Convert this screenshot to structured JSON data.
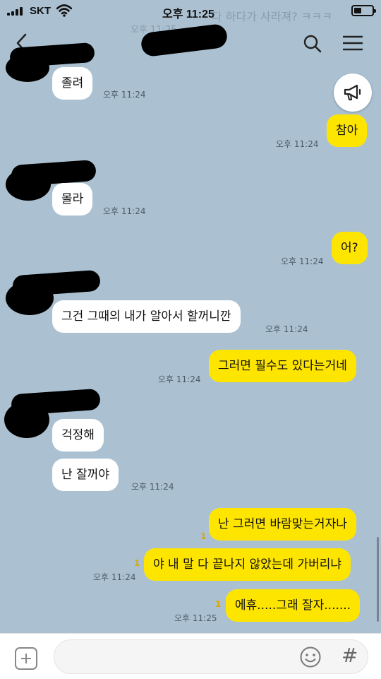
{
  "status_bar": {
    "carrier": "SKT",
    "time": "오후 11:25"
  },
  "ghost_preview": {
    "text": "다 하다가 사라져? ㅋㅋㅋ",
    "time": "오후 11:25"
  },
  "header": {
    "back_icon": "chevron-left-icon",
    "search_icon": "search-icon",
    "menu_icon": "hamburger-menu-icon",
    "notice_icon": "megaphone-icon"
  },
  "messages": [
    {
      "side": "in",
      "text": "졸려",
      "time": "오후 11:24"
    },
    {
      "side": "out",
      "text": "참아",
      "time": "오후 11:24"
    },
    {
      "side": "in",
      "text": "몰라",
      "time": "오후 11:24"
    },
    {
      "side": "out",
      "text": "어?",
      "time": "오후 11:24"
    },
    {
      "side": "in",
      "text": "그건 그때의 내가 알아서 할꺼니깐",
      "time": "오후 11:24"
    },
    {
      "side": "out",
      "text": "그러면 필수도 있다는거네",
      "time": "오후 11:24"
    },
    {
      "side": "in",
      "text": "걱정해"
    },
    {
      "side": "in",
      "text": "난 잘꺼야",
      "time": "오후 11:24"
    },
    {
      "side": "out",
      "text": "난 그러면 바람맞는거자나",
      "unread": "1"
    },
    {
      "side": "out",
      "text": "야 내 말 다 끝나지 않았는데 가버리냐",
      "time": "오후 11:24",
      "unread": "1"
    },
    {
      "side": "out",
      "text": "에휴.....그래 잘자.......",
      "time": "오후 11:25",
      "unread": "1"
    }
  ],
  "input_bar": {
    "add_icon": "plus-square-icon",
    "placeholder": "",
    "emoji_icon": "emoji-icon",
    "hashtag_icon": "hashtag-icon",
    "hashtag_glyph": "#"
  },
  "colors": {
    "background": "#abc1d1",
    "outgoing_bubble": "#fee500",
    "incoming_bubble": "#ffffff",
    "unread": "#d9a800"
  }
}
